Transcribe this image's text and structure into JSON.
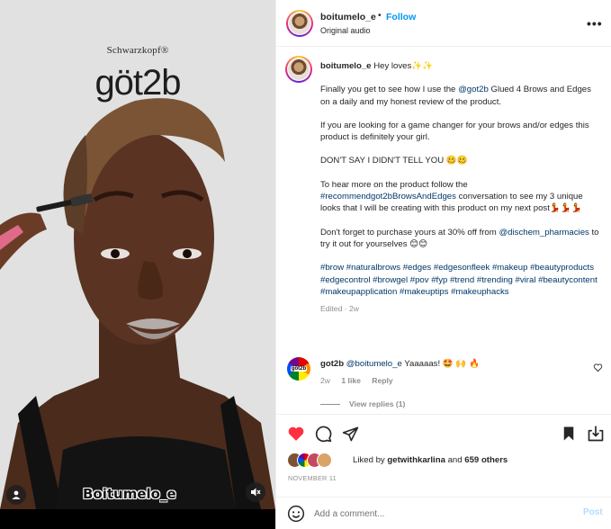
{
  "media": {
    "brand_small": "Schwarzkopf®",
    "brand_logo": "göt2b",
    "overlay_caption": "Boitumelo_e",
    "icons": {
      "user": "user-tag-icon",
      "mute": "speaker-muted-icon"
    }
  },
  "header": {
    "username": "boitumelo_e",
    "separator": "•",
    "follow_label": "Follow",
    "subtitle": "Original audio",
    "more_label": "•••"
  },
  "caption": {
    "username": "boitumelo_e",
    "greeting": "Hey loves✨✨",
    "p1_a": "Finally you get to see how I use the ",
    "p1_mention": "@got2b",
    "p1_b": " Glued 4 Brows and Edges on a daily and my honest review of the product.",
    "p2": "If you are looking for a game changer for your brows and/or edges this product is definitely your girl.",
    "p3": "DON'T SAY I DIDN'T TELL YOU 🥴🥴",
    "p4_a": "To hear more on the product follow the ",
    "p4_tag": "#recommendgot2bBrowsAndEdges",
    "p4_b": " conversation to see my 3 unique looks that I will be creating with this product on my next post💃💃💃",
    "p5_a": "Don't forget to purchase yours at 30% off from ",
    "p5_mention": "@dischem_pharmacies",
    "p5_b": " to try it out for yourselves 😊😊",
    "hashtags": "#brow #naturalbrows #edges #edgesonfleek #makeup #beautyproducts #edgecontrol #browgel #pov #fyp #trend #trending #viral #beautycontent #makeupapplication #makeuptips #makeuphacks",
    "meta": "Edited · 2w"
  },
  "reply": {
    "avatar_label": "göt2b",
    "username": "got2b",
    "mention": "@boitumelo_e",
    "text": " Yaaaaas! 🤩 🙌 🔥",
    "age": "2w",
    "likes": "1 like",
    "reply_label": "Reply",
    "view_replies": "View replies (1)"
  },
  "actions": {
    "icons": [
      "heart-filled-icon",
      "comment-icon",
      "share-icon",
      "bookmark-icon",
      "collection-icon"
    ],
    "liked_by_prefix": "Liked by ",
    "liked_by_user": "getwithkarlina",
    "liked_by_mid": " and ",
    "liked_by_count": "659 others",
    "date": "NOVEMBER 11"
  },
  "comment_box": {
    "placeholder": "Add a comment...",
    "post_label": "Post"
  },
  "colors": {
    "accent": "#0095f6",
    "like_red": "#ff3040",
    "link": "#00376b",
    "muted": "#8e8e8e"
  }
}
